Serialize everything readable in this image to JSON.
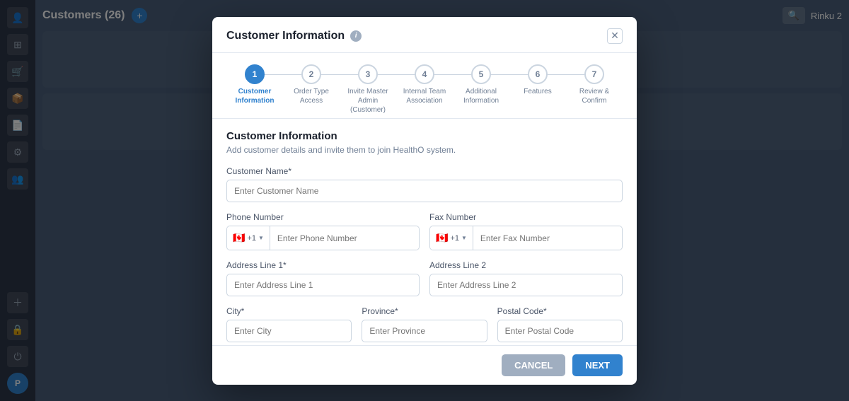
{
  "app": {
    "title": "Customers (26)",
    "user": "Rinku 2"
  },
  "sidebar": {
    "icons": [
      {
        "name": "add-customer-icon",
        "symbol": "👤+"
      },
      {
        "name": "grid-icon",
        "symbol": "⊞"
      },
      {
        "name": "cart-icon",
        "symbol": "🛒"
      },
      {
        "name": "package-icon",
        "symbol": "📦"
      },
      {
        "name": "document-icon",
        "symbol": "📄"
      },
      {
        "name": "settings-icon",
        "symbol": "⚙"
      },
      {
        "name": "user-icon",
        "symbol": "👤"
      },
      {
        "name": "add-circle-icon",
        "symbol": "+"
      },
      {
        "name": "lock-icon",
        "symbol": "🔒"
      },
      {
        "name": "power-icon",
        "symbol": "⏻"
      },
      {
        "name": "avatar-icon",
        "symbol": "P"
      }
    ]
  },
  "modal": {
    "title": "Customer Information",
    "close_label": "✕",
    "steps": [
      {
        "number": "1",
        "label": "Customer\nInformation",
        "active": true
      },
      {
        "number": "2",
        "label": "Order Type Access",
        "active": false
      },
      {
        "number": "3",
        "label": "Invite Master\nAdmin (Customer)",
        "active": false
      },
      {
        "number": "4",
        "label": "Internal Team\nAssociation",
        "active": false
      },
      {
        "number": "5",
        "label": "Additional\nInformation",
        "active": false
      },
      {
        "number": "6",
        "label": "Features",
        "active": false
      },
      {
        "number": "7",
        "label": "Review & Confirm",
        "active": false
      }
    ],
    "section_title": "Customer Information",
    "section_desc": "Add customer details and invite them to join HealthO system.",
    "fields": {
      "customer_name": {
        "label": "Customer Name*",
        "placeholder": "Enter Customer Name"
      },
      "phone_number": {
        "label": "Phone Number",
        "placeholder": "Enter Phone Number",
        "country_code": "+1",
        "flag": "🇨🇦"
      },
      "fax_number": {
        "label": "Fax Number",
        "placeholder": "Enter Fax Number",
        "country_code": "+1",
        "flag": "🇨🇦"
      },
      "address_line1": {
        "label": "Address Line 1*",
        "placeholder": "Enter Address Line 1"
      },
      "address_line2": {
        "label": "Address Line 2",
        "placeholder": "Enter Address Line 2"
      },
      "city": {
        "label": "City*",
        "placeholder": "Enter City"
      },
      "province": {
        "label": "Province*",
        "placeholder": "Enter Province"
      },
      "postal_code": {
        "label": "Postal Code*",
        "placeholder": "Enter Postal Code"
      }
    },
    "buttons": {
      "cancel": "CANCEL",
      "next": "NEXT"
    }
  }
}
